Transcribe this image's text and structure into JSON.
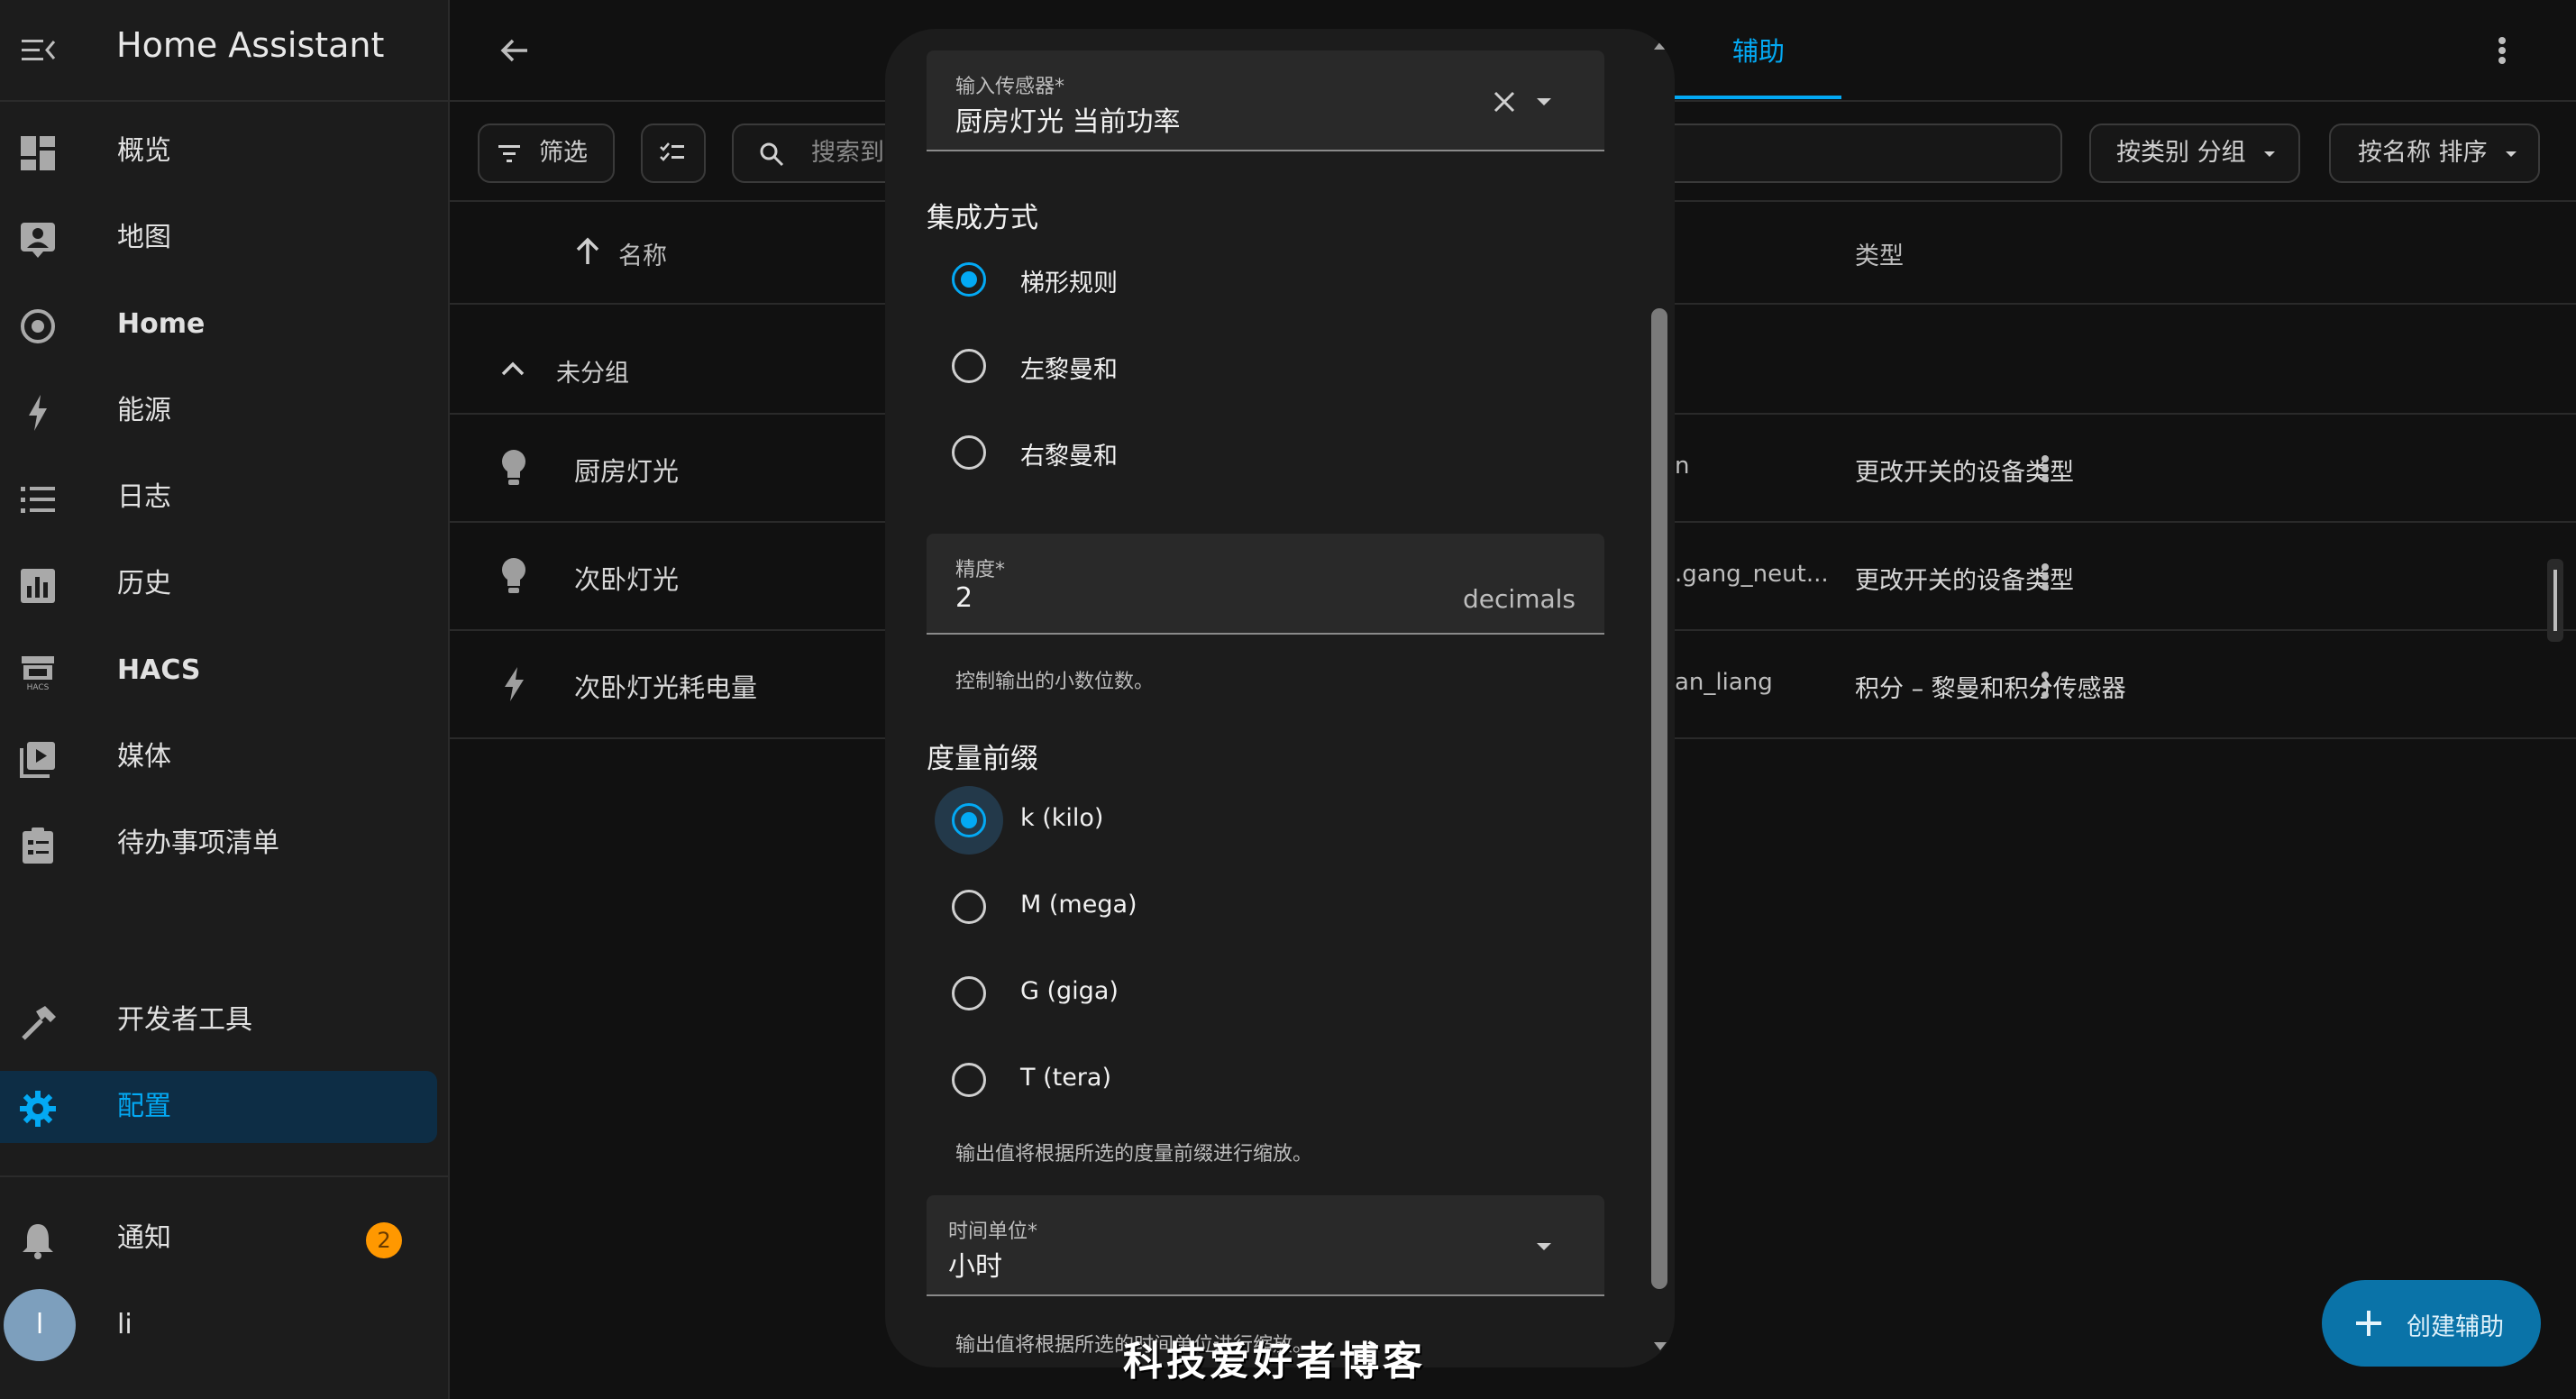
{
  "sidebar": {
    "app_title": "Home Assistant",
    "items": [
      {
        "label": "概览",
        "icon": "dashboard-icon"
      },
      {
        "label": "地图",
        "icon": "map-icon"
      },
      {
        "label": "Home",
        "icon": "home-circle-icon"
      },
      {
        "label": "能源",
        "icon": "lightning-icon"
      },
      {
        "label": "日志",
        "icon": "list-icon"
      },
      {
        "label": "历史",
        "icon": "chart-icon"
      },
      {
        "label": "HACS",
        "icon": "hacs-icon"
      },
      {
        "label": "媒体",
        "icon": "media-icon"
      },
      {
        "label": "待办事项清单",
        "icon": "clipboard-icon"
      }
    ],
    "developer_tools": "开发者工具",
    "settings": "配置",
    "notifications": "通知",
    "notification_count": "2",
    "user_initial": "l",
    "user_name": "li"
  },
  "topbar": {
    "active_tab": "辅助"
  },
  "toolbar": {
    "filter_label": "筛选",
    "search_placeholder": "搜索到",
    "group_by_label": "按类别 分组",
    "sort_label": "按名称 排序"
  },
  "table": {
    "col_name": "名称",
    "col_type": "类型",
    "group_label": "未分组",
    "rows": [
      {
        "name": "厨房灯光",
        "entity_fragment": "n",
        "type": "更改开关的设备类型"
      },
      {
        "name": "次卧灯光",
        "entity_fragment": ".gang_neut...",
        "type": "更改开关的设备类型"
      },
      {
        "name": "次卧灯光耗电量",
        "entity_fragment": "an_liang",
        "type": "积分 – 黎曼和积分传感器"
      }
    ]
  },
  "dialog": {
    "input_sensor_label": "输入传感器*",
    "input_sensor_value": "厨房灯光 当前功率",
    "integration_method_title": "集成方式",
    "integration_methods": [
      "梯形规则",
      "左黎曼和",
      "右黎曼和"
    ],
    "integration_selected": 0,
    "precision_label": "精度*",
    "precision_value": "2",
    "precision_suffix": "decimals",
    "precision_helper": "控制输出的小数位数。",
    "prefix_title": "度量前缀",
    "prefixes": [
      "k (kilo)",
      "M (mega)",
      "G (giga)",
      "T (tera)"
    ],
    "prefix_selected": 0,
    "prefix_helper": "输出值将根据所选的度量前缀进行缩放。",
    "time_unit_label": "时间单位*",
    "time_unit_value": "小时",
    "time_unit_helper": "输出值将根据所选的时间单位进行缩放。"
  },
  "fab": {
    "label": "创建辅助"
  },
  "watermark": "科技爱好者博客",
  "colors": {
    "accent": "#03a9f4",
    "badge": "#ff9800",
    "fab": "#0a73a8",
    "active_nav_bg": "#0d2d45"
  }
}
